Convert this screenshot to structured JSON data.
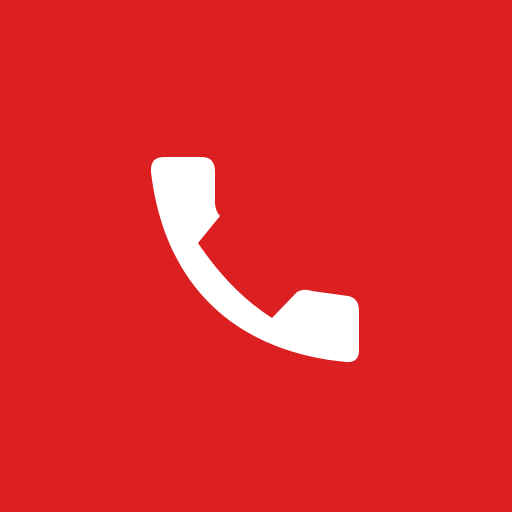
{
  "app_icon": {
    "icon": "phone-icon",
    "background_color": "#dc1f21",
    "glyph_color": "#ffffff"
  }
}
